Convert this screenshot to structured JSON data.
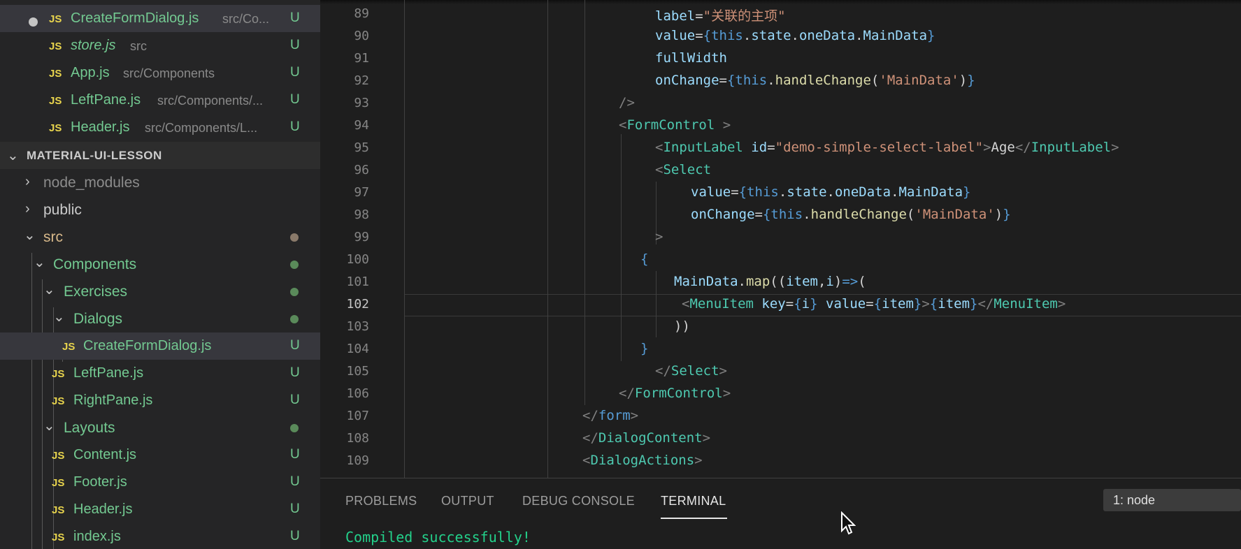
{
  "explorer": {
    "open_editors": [
      {
        "name": "CreateFormDialog.js",
        "path": "src/Co...",
        "status": "U",
        "dirty": true
      },
      {
        "name": "store.js",
        "path": "src",
        "status": "U",
        "italic": true
      },
      {
        "name": "App.js",
        "path": "src/Components",
        "status": "U"
      },
      {
        "name": "LeftPane.js",
        "path": "src/Components/...",
        "status": "U"
      },
      {
        "name": "Header.js",
        "path": "src/Components/L...",
        "status": "U"
      }
    ],
    "project_title": "MATERIAL-UI-LESSON",
    "folders": {
      "node_modules": "node_modules",
      "public": "public",
      "src": "src",
      "components": "Components",
      "exercises": "Exercises",
      "dialogs": "Dialogs",
      "layouts": "Layouts"
    },
    "files": {
      "create_form_dialog": {
        "name": "CreateFormDialog.js",
        "status": "U"
      },
      "left_pane": {
        "name": "LeftPane.js",
        "status": "U"
      },
      "right_pane": {
        "name": "RightPane.js",
        "status": "U"
      },
      "content": {
        "name": "Content.js",
        "status": "U"
      },
      "footer": {
        "name": "Footer.js",
        "status": "U"
      },
      "header": {
        "name": "Header.js",
        "status": "U"
      },
      "index": {
        "name": "index.js",
        "status": "U"
      }
    },
    "file_icon_label": "JS",
    "colors": {
      "untracked": "#73c991",
      "modified_dot": "#8a7a6a",
      "folder_dot": "#5a8a5a"
    }
  },
  "editor": {
    "current_line": 102,
    "lines": [
      {
        "n": 89,
        "text": "label=\"关联的主项\""
      },
      {
        "n": 90,
        "text": "value={this.state.oneData.MainData}"
      },
      {
        "n": 91,
        "text": "fullWidth"
      },
      {
        "n": 92,
        "text": "onChange={this.handleChange('MainData')}"
      },
      {
        "n": 93,
        "text": "/>"
      },
      {
        "n": 94,
        "text": "<FormControl >"
      },
      {
        "n": 95,
        "text": "<InputLabel id=\"demo-simple-select-label\">Age</InputLabel>"
      },
      {
        "n": 96,
        "text": "<Select"
      },
      {
        "n": 97,
        "text": "value={this.state.oneData.MainData}"
      },
      {
        "n": 98,
        "text": "onChange={this.handleChange('MainData')}"
      },
      {
        "n": 99,
        "text": ">"
      },
      {
        "n": 100,
        "text": "{"
      },
      {
        "n": 101,
        "text": "MainData.map((item,i)=>("
      },
      {
        "n": 102,
        "text": "<MenuItem key={i} value={item}>{item}</MenuItem>"
      },
      {
        "n": 103,
        "text": "))"
      },
      {
        "n": 104,
        "text": "}"
      },
      {
        "n": 105,
        "text": "</Select>"
      },
      {
        "n": 106,
        "text": "</FormControl>"
      },
      {
        "n": 107,
        "text": "</form>"
      },
      {
        "n": 108,
        "text": "</DialogContent>"
      },
      {
        "n": 109,
        "text": "<DialogActions>"
      }
    ]
  },
  "panel": {
    "tabs": [
      "PROBLEMS",
      "OUTPUT",
      "DEBUG CONSOLE",
      "TERMINAL"
    ],
    "active_tab": "TERMINAL",
    "terminal_select": "1: node",
    "terminal_output": "Compiled successfully!"
  }
}
